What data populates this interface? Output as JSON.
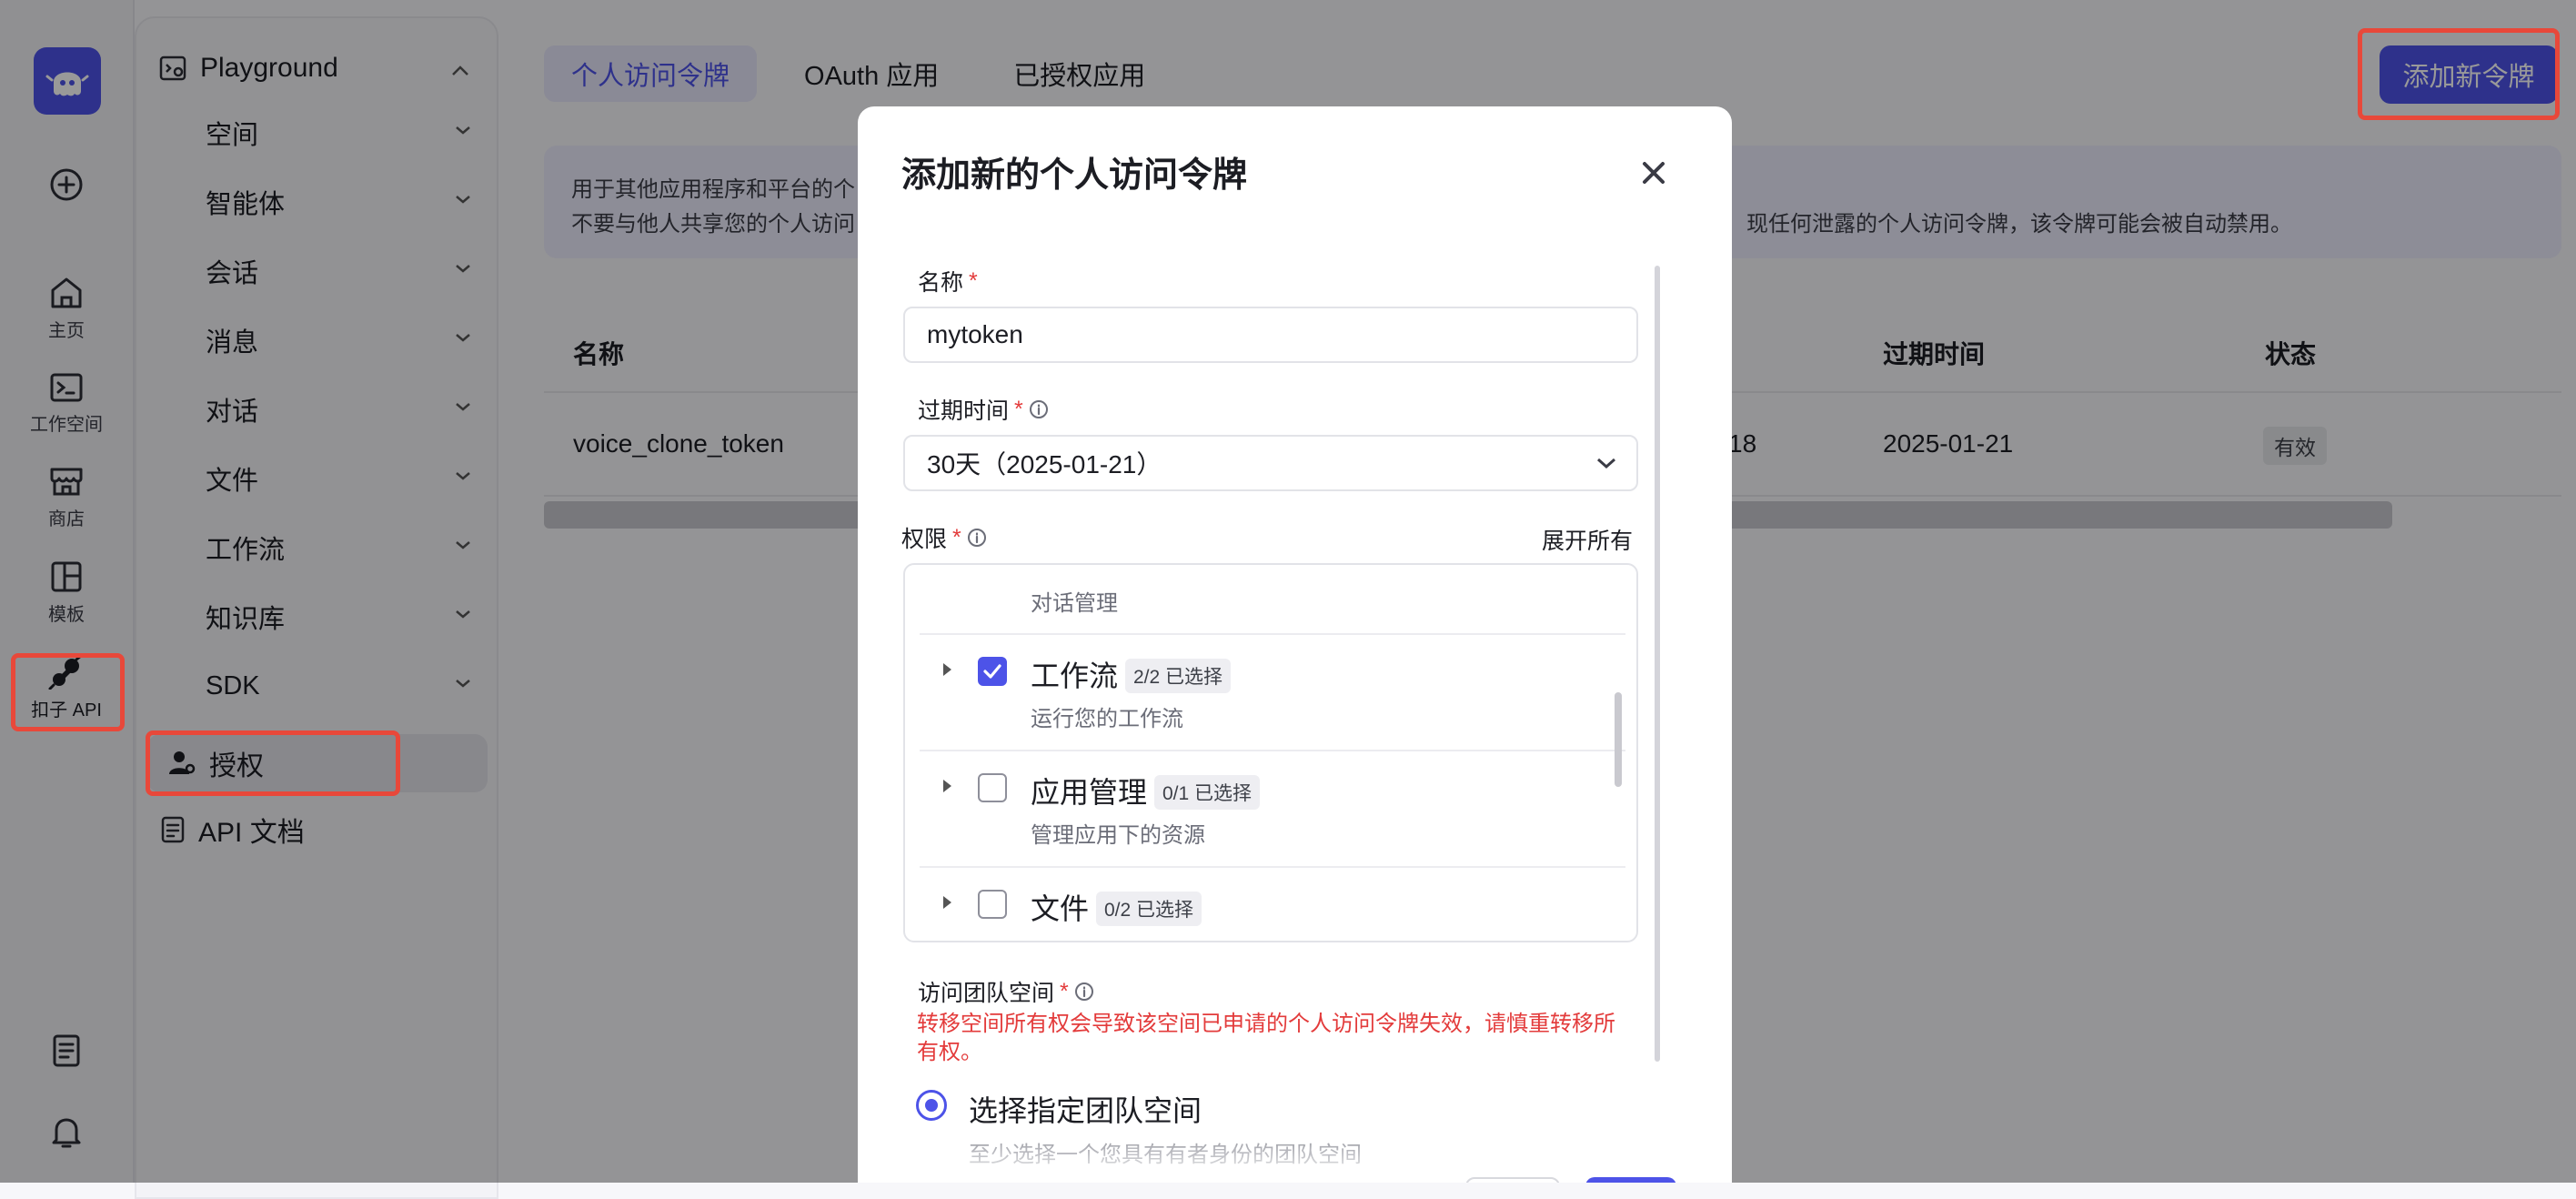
{
  "rail": {
    "items": [
      {
        "label": "主页",
        "icon": "home-icon"
      },
      {
        "label": "工作空间",
        "icon": "terminal-icon"
      },
      {
        "label": "商店",
        "icon": "store-icon"
      },
      {
        "label": "模板",
        "icon": "template-icon"
      },
      {
        "label": "扣子 API",
        "icon": "plug-icon"
      }
    ]
  },
  "nav": {
    "section_title": "Playground",
    "items": [
      "空间",
      "智能体",
      "会话",
      "消息",
      "对话",
      "文件",
      "工作流",
      "知识库",
      "SDK"
    ],
    "auth_label": "授权",
    "api_docs_label": "API 文档"
  },
  "tabs": [
    "个人访问令牌",
    "OAuth 应用",
    "已授权应用"
  ],
  "add_button": "添加新令牌",
  "notice": {
    "line1": "用于其他应用程序和平台的个",
    "line2a": "不要与他人共享您的个人访问",
    "line2b": "现任何泄露的个人访问令牌，该令牌可能会被自动禁用。"
  },
  "table": {
    "headers": {
      "name": "名称",
      "expire": "过期时间",
      "status": "状态"
    },
    "rows": [
      {
        "name": "voice_clone_token",
        "partial": "18",
        "expire": "2025-01-21",
        "status": "有效"
      }
    ]
  },
  "modal": {
    "title": "添加新的个人访问令牌",
    "name_label": "名称",
    "name_value": "mytoken",
    "expire_label": "过期时间",
    "expire_value": "30天（2025-01-21）",
    "perm_label": "权限",
    "expand_all": "展开所有",
    "perm_top_sub": "对话管理",
    "permissions": [
      {
        "name": "工作流",
        "tag": "2/2 已选择",
        "desc": "运行您的工作流",
        "checked": true
      },
      {
        "name": "应用管理",
        "tag": "0/1 已选择",
        "desc": "管理应用下的资源",
        "checked": false
      },
      {
        "name": "文件",
        "tag": "0/2 已选择",
        "desc": "",
        "checked": false
      }
    ],
    "team_label": "访问团队空间",
    "team_warning": "转移空间所有权会导致该空间已申请的个人访问令牌失效，请慎重转移所有权。",
    "radio_label": "选择指定团队空间",
    "radio_sub": "至少选择一个您具有有者身份的团队空间"
  },
  "colors": {
    "accent": "#4d53e8",
    "danger": "#e33b3b",
    "highlight": "#e8483a"
  }
}
